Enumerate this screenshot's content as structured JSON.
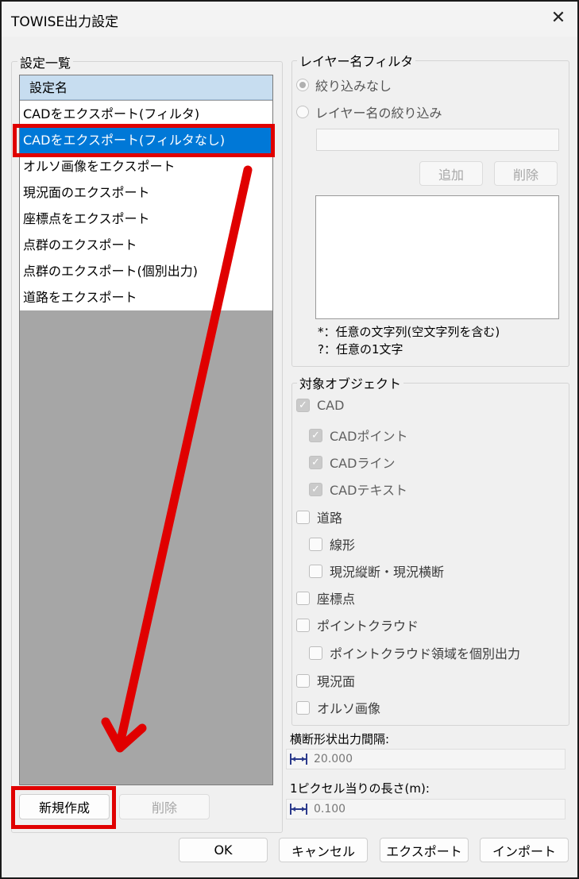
{
  "window": {
    "title": "TOWISE出力設定",
    "close_glyph": "✕"
  },
  "settings_list": {
    "group_label": "設定一覧",
    "header": "設定名",
    "items": [
      "CADをエクスポート(フィルタ)",
      "CADをエクスポート(フィルタなし)",
      "オルソ画像をエクスポート",
      "現況面のエクスポート",
      "座標点をエクスポート",
      "点群のエクスポート",
      "点群のエクスポート(個別出力)",
      "道路をエクスポート"
    ],
    "selected_index": 1,
    "new_button": "新規作成",
    "delete_button": "削除"
  },
  "layer_filter": {
    "group_label": "レイヤー名フィルタ",
    "radio_none": "絞り込みなし",
    "radio_filter": "レイヤー名の絞り込み",
    "add_button": "追加",
    "delete_button": "削除",
    "hint1": "*：任意の文字列(空文字列を含む)",
    "hint2": "?：任意の1文字"
  },
  "target_objects": {
    "group_label": "対象オブジェクト",
    "items": [
      {
        "label": "CAD",
        "checked": true
      },
      {
        "label": "CADポイント",
        "checked": true
      },
      {
        "label": "CADライン",
        "checked": true
      },
      {
        "label": "CADテキスト",
        "checked": true
      },
      {
        "label": "道路",
        "checked": false
      },
      {
        "label": "線形",
        "checked": false
      },
      {
        "label": "現況縦断・現況横断",
        "checked": false
      },
      {
        "label": "座標点",
        "checked": false
      },
      {
        "label": "ポイントクラウド",
        "checked": false
      },
      {
        "label": "ポイントクラウド領域を個別出力",
        "checked": false
      },
      {
        "label": "現況面",
        "checked": false
      },
      {
        "label": "オルソ画像",
        "checked": false
      }
    ]
  },
  "cross_section": {
    "label": "横断形状出力間隔:",
    "value": "20.000"
  },
  "pixel_length": {
    "label": "1ピクセル当りの長さ(m):",
    "value": "0.100"
  },
  "footer": {
    "ok": "OK",
    "cancel": "キャンセル",
    "export": "エクスポート",
    "import": "インポート"
  },
  "colors": {
    "annotation_red": "#e00000",
    "selection_blue": "#0078d7",
    "list_header": "#c7ddf0"
  }
}
